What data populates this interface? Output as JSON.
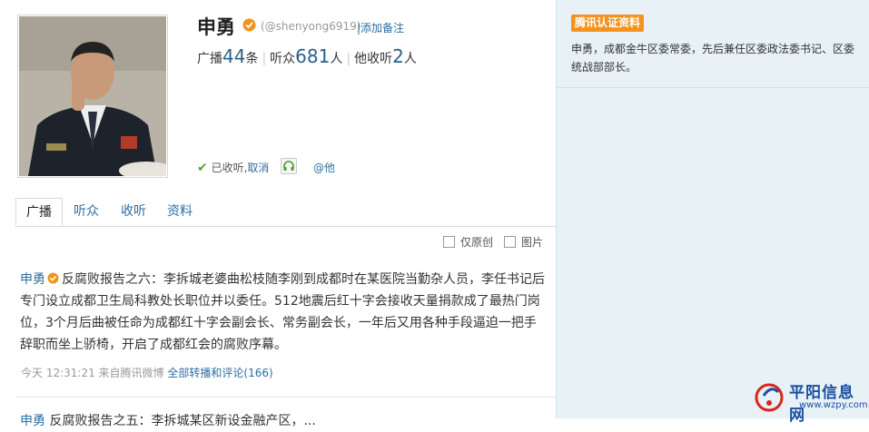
{
  "profile": {
    "name": "申勇",
    "handle": "(@shenyong6919)",
    "add_note": "添加备注",
    "stats": {
      "broadcast_label": "广播",
      "broadcast_count": "44",
      "broadcast_unit": "条",
      "listeners_label": "听众",
      "listeners_count": "681",
      "listeners_unit": "人",
      "following_label": "他收听",
      "following_count": "2",
      "following_unit": "人"
    },
    "follow_status": "已收听,",
    "cancel": "取消",
    "at": "@他"
  },
  "tabs": [
    {
      "label": "广播"
    },
    {
      "label": "听众"
    },
    {
      "label": "收听"
    },
    {
      "label": "资料"
    }
  ],
  "filters": {
    "original_only": "仅原创",
    "images": "图片"
  },
  "post": {
    "author": "申勇",
    "text": "反腐败报告之六：李拆城老婆曲松枝随李刚到成都时在某医院当勤杂人员，李任书记后专门设立成都卫生局科教处长职位并以委任。512地震后红十字会接收天量捐款成了最热门岗位，3个月后曲被任命为成都红十字会副会长、常务副会长，一年后又用各种手段逼迫一把手辞职而坐上骄椅，开启了成都红会的腐败序幕。",
    "time": "今天 12:31:21",
    "source": "来自腾讯微博",
    "all_reposts": "全部转播和评论",
    "count": "(166)"
  },
  "post2": {
    "author": "申勇",
    "text": "反腐败报告之五：李拆城某区新设金融产区，..."
  },
  "sidebar": {
    "badge": "腾讯认证资料",
    "bio": "申勇，成都金牛区委常委，先后兼任区委政法委书记、区委统战部部长。"
  },
  "watermark": {
    "name": "平阳信息网",
    "url": "www.wzpy.com"
  },
  "colors": {
    "link": "#2c6fa3",
    "badge": "#f3931e",
    "sidebar_bg": "#e8f1f6"
  }
}
